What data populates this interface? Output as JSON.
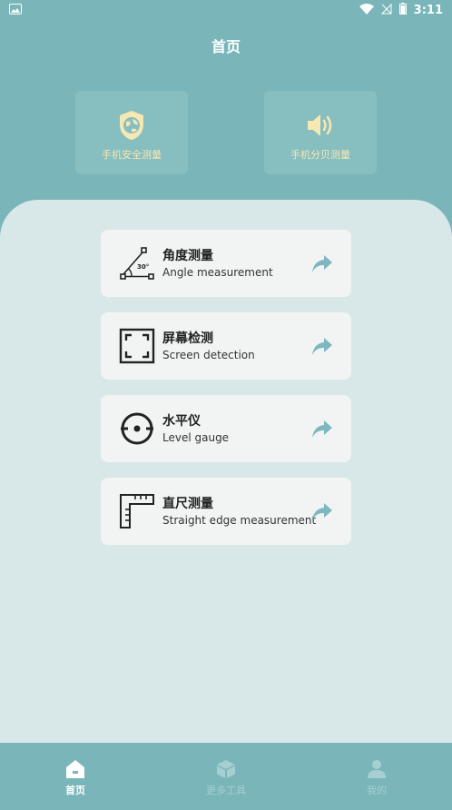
{
  "status_bar": {
    "time": "3:11"
  },
  "header": {
    "title": "首页"
  },
  "top_cards": [
    {
      "label": "手机安全测量",
      "icon": "shield-globe-icon"
    },
    {
      "label": "手机分贝测量",
      "icon": "speaker-icon"
    }
  ],
  "tools": [
    {
      "title": "角度测量",
      "subtitle": "Angle measurement",
      "icon": "angle-icon",
      "angle_text": "30°"
    },
    {
      "title": "屏幕检测",
      "subtitle": "Screen detection",
      "icon": "screen-frame-icon"
    },
    {
      "title": "水平仪",
      "subtitle": "Level gauge",
      "icon": "level-icon"
    },
    {
      "title": "直尺测量",
      "subtitle": "Straight edge measurement",
      "icon": "ruler-icon"
    }
  ],
  "bottom_nav": [
    {
      "label": "首页",
      "icon": "home-icon",
      "active": true
    },
    {
      "label": "更多工具",
      "icon": "cube-icon",
      "active": false
    },
    {
      "label": "我的",
      "icon": "user-icon",
      "active": false
    }
  ],
  "colors": {
    "background": "#79b5b9",
    "panel": "#d8e8e8",
    "card": "#f2f4f4",
    "card_label": "#f6e8b3",
    "arrow": "#7fb7c0"
  }
}
